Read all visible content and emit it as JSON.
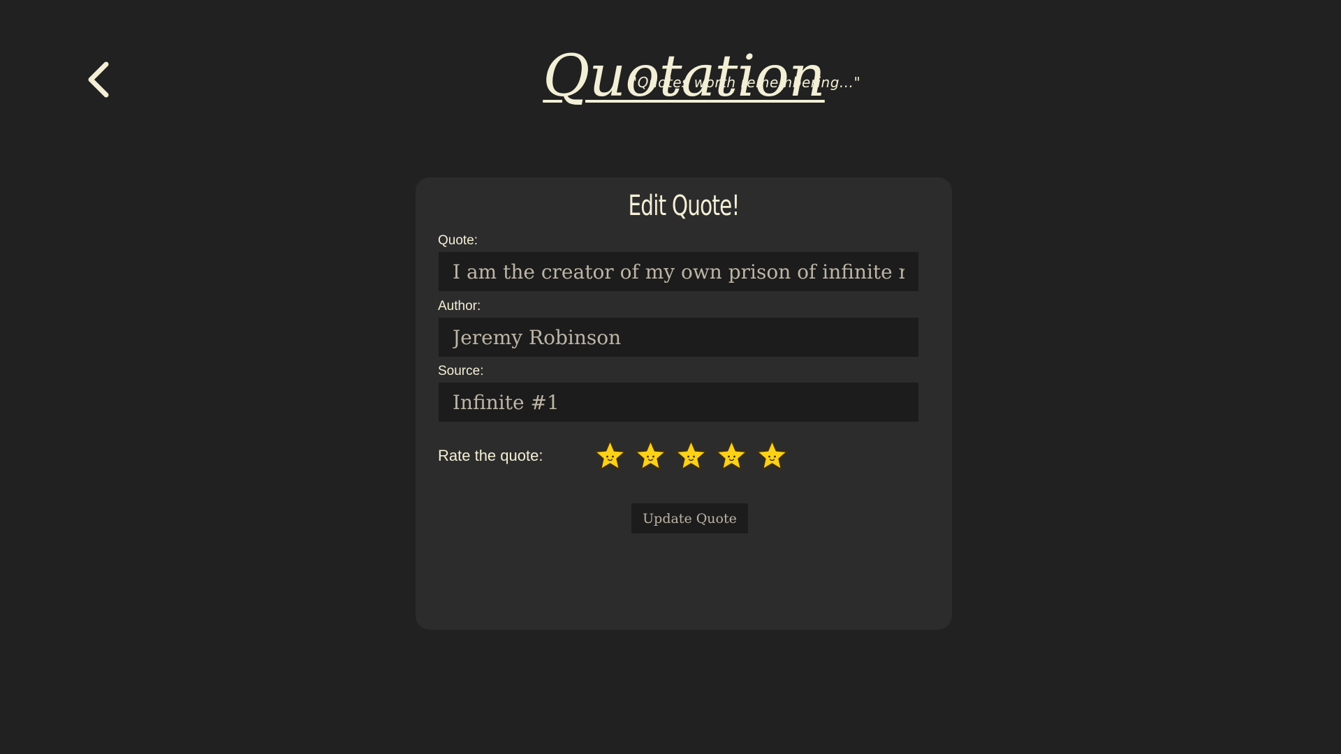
{
  "header": {
    "back_icon": "chevron-left-icon",
    "title": "Quotation",
    "tagline": "\"Quotes worth remembering...\""
  },
  "form": {
    "title": "Edit Quote!",
    "quote_label": "Quote:",
    "quote_value": "I am the creator of my own prison of infinite regret",
    "author_label": "Author:",
    "author_value": "Jeremy Robinson",
    "source_label": "Source:",
    "source_value": "Infinite #1",
    "rating_label": "Rate the quote:",
    "rating": 5,
    "rating_max": 5,
    "star_icon": "smiling-star-icon",
    "submit_label": "Update Quote"
  },
  "colors": {
    "background": "#212121",
    "card": "#2c2c2c",
    "input": "#1c1c1c",
    "text_light": "#f3efd6",
    "text_muted": "#bdb5a6",
    "star_fill": "#fcd116",
    "star_outline": "#3a2e12"
  }
}
